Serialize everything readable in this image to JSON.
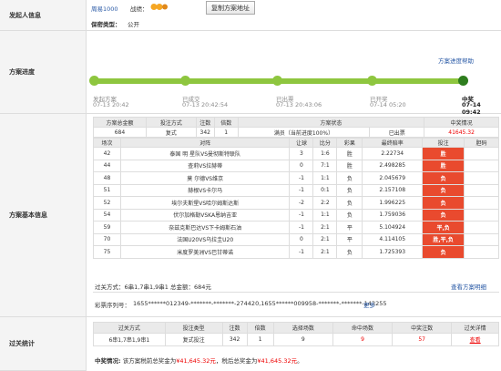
{
  "labels": {
    "initiator": "发起人信息",
    "progress": "方案进度",
    "basic": "方案基本信息",
    "stats": "过关统计"
  },
  "initiator": {
    "username": "周易1000",
    "record_label": "战绩：",
    "copy_button": "复制方案地址",
    "privacy_label": "保密类型：",
    "privacy_value": "公开"
  },
  "progress": {
    "help_link": "方案进度帮助",
    "steps": [
      {
        "name": "发起方案",
        "time": "07-13 20:42"
      },
      {
        "name": "已成交",
        "time": "07-13 20:42:54"
      },
      {
        "name": "已出票",
        "time": "07-13 20:43:06"
      },
      {
        "name": "已开奖",
        "time": "07-14 05:20"
      },
      {
        "name": "中奖",
        "time": "07-14 09:42"
      }
    ]
  },
  "summary": {
    "headers": [
      "方案总金额",
      "投注方式",
      "注数",
      "倍数",
      "方案状态",
      "",
      "中奖情况"
    ],
    "values": [
      "684",
      "复式",
      "342",
      "1",
      "满员（当前进度100%）",
      "已出票",
      "41645.32"
    ]
  },
  "matches": {
    "headers": [
      "场次",
      "对阵",
      "让球",
      "比分",
      "彩果",
      "最终赔率",
      "投注",
      "胆码"
    ],
    "rows": [
      [
        "42",
        "泰国 明 星队VS曼彻斯特联队",
        "3",
        "1:6",
        "胜",
        "2.22734",
        "胜",
        ""
      ],
      [
        "44",
        "查莉VS拉赫蒂",
        "0",
        "7:1",
        "胜",
        "2.498285",
        "胜",
        ""
      ],
      [
        "48",
        "莫 尔德VS维京",
        "-1",
        "1:1",
        "负",
        "2.045679",
        "负",
        ""
      ],
      [
        "51",
        "赫根VS卡尔马",
        "-1",
        "0:1",
        "负",
        "2.157108",
        "负",
        ""
      ],
      [
        "52",
        "埃尔夫斯堡VS哈尔姆斯达斯",
        "-2",
        "2:2",
        "负",
        "1.996225",
        "负",
        ""
      ],
      [
        "54",
        "伏尔加格勒VSKA恩纳吉亚",
        "-1",
        "1:1",
        "负",
        "1.759036",
        "负",
        ""
      ],
      [
        "59",
        "奈兹克斯巴达VS下卡姆斯石油",
        "-1",
        "2:1",
        "平",
        "5.104924",
        "平,负",
        ""
      ],
      [
        "70",
        "法国U20VS乌拉圭U20",
        "0",
        "2:1",
        "平",
        "4.114105",
        "胜,平,负",
        ""
      ],
      [
        "75",
        "米度罗美洲VS巴甘蒂诺",
        "-1",
        "2:1",
        "负",
        "1.725393",
        "负",
        ""
      ]
    ]
  },
  "pass_info": {
    "pass_text": "过关方式：6串1,7串1,9串1 总金额：684元",
    "detail_link": "查看方案明细",
    "serial_label": "彩票序列号：",
    "serial_value": "1655******012349-*******-*******-274420,1655******009958-*******-*******-143255",
    "more_link": "更多"
  },
  "stats": {
    "headers": [
      "过关方式",
      "投注类型",
      "注数",
      "倍数",
      "选择场数",
      "命中场数",
      "中奖注数",
      "过关详情"
    ],
    "values": [
      "6串1,7串1,9串1",
      "复式投注",
      "342",
      "1",
      "9",
      "9",
      "57",
      "查看"
    ],
    "summary_label": "中奖情况:",
    "summary_text": "该方案税前总奖金为",
    "pre_tax": "¥41,645.32元",
    "after_text": "，税后总奖金为",
    "after_tax": "¥41,645.32元",
    "end": "。"
  },
  "colors": {
    "accent_red": "#e94a2e",
    "progress_green": "#8ec63f",
    "link_blue": "#2a5aa6"
  }
}
